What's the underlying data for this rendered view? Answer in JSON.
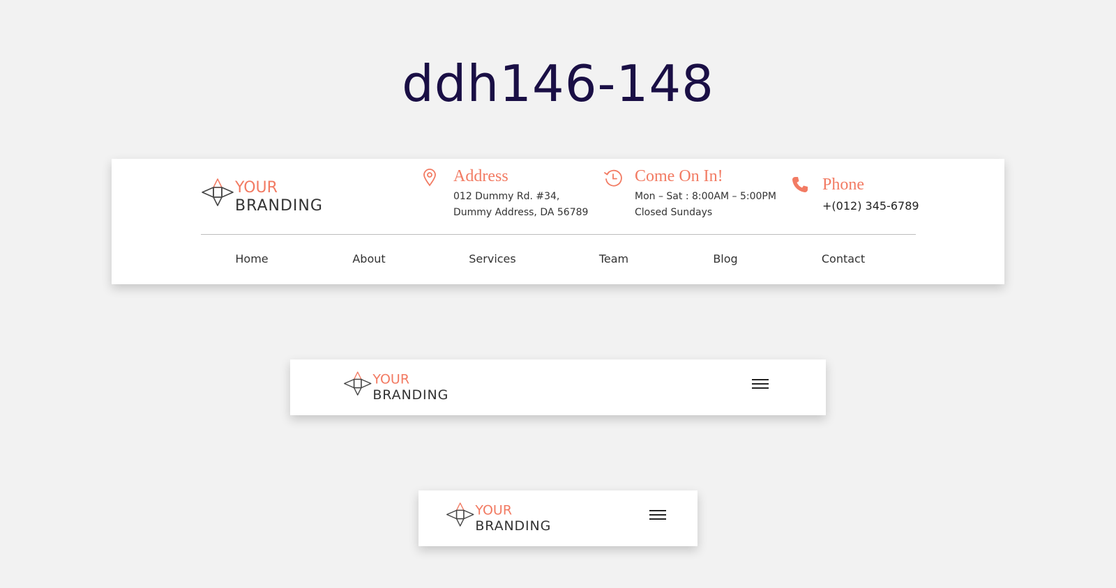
{
  "page": {
    "title": "ddh146-148"
  },
  "colors": {
    "accent": "#f27b63",
    "dark": "#333333",
    "title": "#1a0f45"
  },
  "brand": {
    "line1": "YOUR",
    "line2": "BRANDING"
  },
  "header_full": {
    "address": {
      "icon": "map-pin-icon",
      "title": "Address",
      "line1": "012 Dummy Rd. #34,",
      "line2": "Dummy Address, DA 56789"
    },
    "hours": {
      "icon": "clock-history-icon",
      "title": "Come On In!",
      "line1": "Mon – Sat : 8:00AM – 5:00PM",
      "line2": "Closed Sundays"
    },
    "phone": {
      "icon": "phone-icon",
      "title": "Phone",
      "number": "+(012) 345-6789"
    },
    "nav": [
      "Home",
      "About",
      "Services",
      "Team",
      "Blog",
      "Contact"
    ]
  },
  "header_compact": {
    "menu_icon": "hamburger-menu-icon"
  }
}
